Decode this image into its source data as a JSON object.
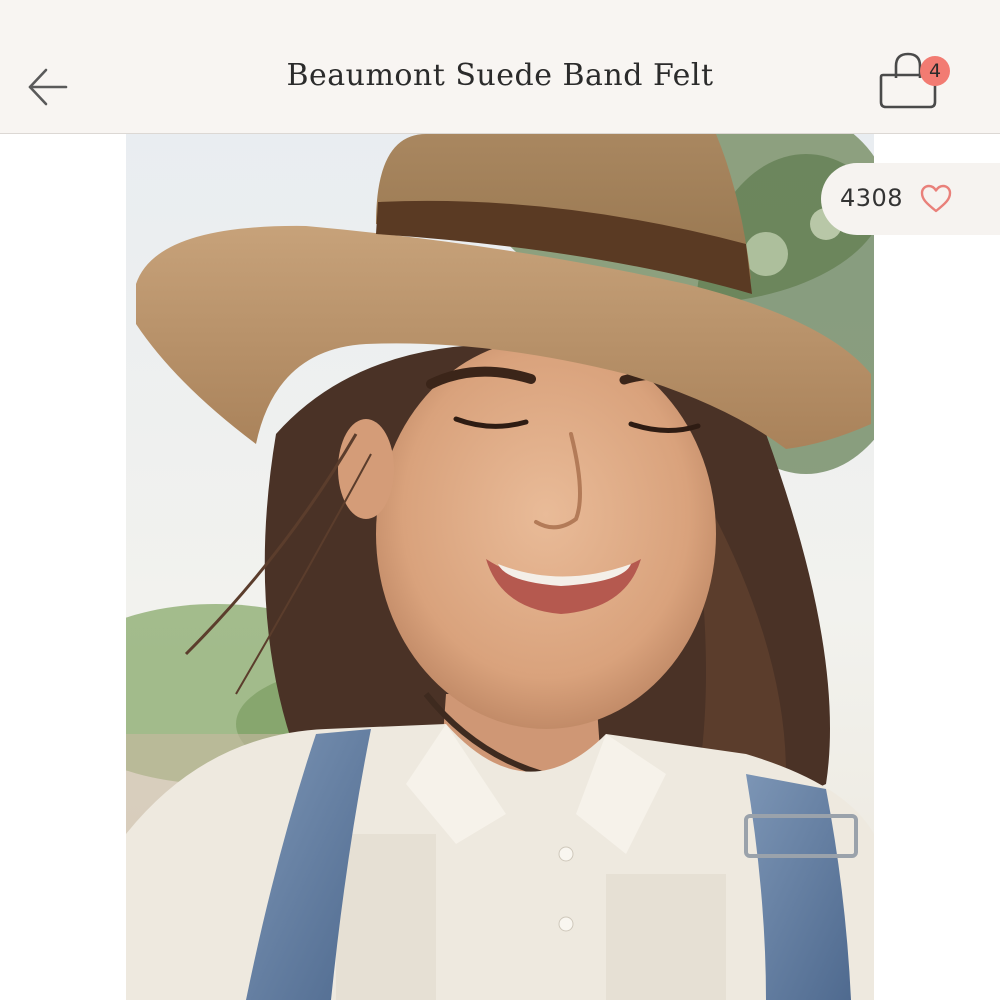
{
  "header": {
    "title": "Beaumont Suede Band Felt",
    "back_icon": "arrow-left-icon",
    "cart_icon": "shopping-bag-icon",
    "cart_count": "4"
  },
  "product_image": {
    "alt": "Beaumont Suede Band Felt"
  },
  "likes": {
    "count": "4308",
    "icon": "heart-outline-icon"
  },
  "colors": {
    "header_bg": "#f8f5f2",
    "badge": "#f27b72",
    "heart": "#e9807a",
    "text": "#2b2b2b"
  }
}
